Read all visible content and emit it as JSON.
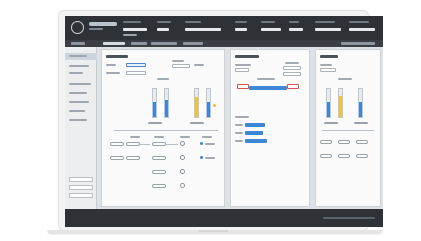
{
  "app": {
    "title": "",
    "header": {
      "brand": "",
      "stats": [
        "",
        "",
        "",
        "",
        "",
        "",
        "",
        ""
      ]
    },
    "subbar": {
      "tabs": [
        "",
        "",
        "",
        "",
        "",
        ""
      ]
    },
    "sidebar": {
      "items": [
        "",
        "",
        "",
        "",
        "",
        "",
        "",
        ""
      ],
      "buttons": [
        "",
        "",
        ""
      ]
    },
    "panels": [
      {
        "title": ""
      },
      {
        "title": ""
      },
      {
        "title": ""
      }
    ],
    "footer": {
      "text": ""
    }
  },
  "colors": {
    "header_bg": "#2e3136",
    "content_bg": "#dfe2e5",
    "panel_bg": "#fbfbfc",
    "accent_blue": "#3c88d6",
    "accent_yellow": "#f1c232",
    "accent_red": "#d9534f"
  },
  "icons": {
    "logo": "brand-logo-icon"
  }
}
